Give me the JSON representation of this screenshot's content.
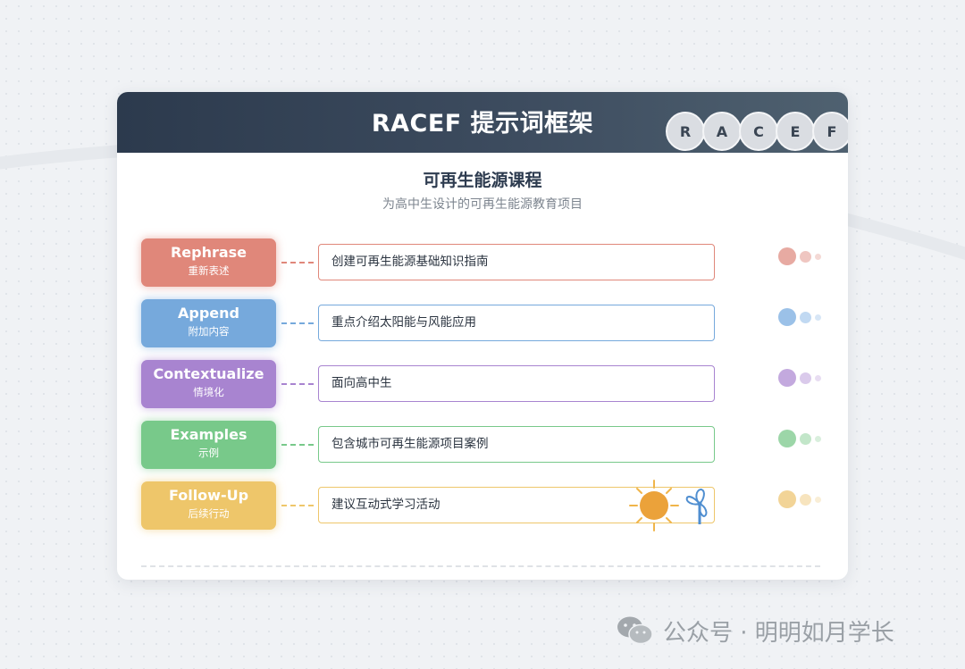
{
  "header": {
    "title": "RACEF 提示词框架",
    "letters": [
      "R",
      "A",
      "C",
      "E",
      "F"
    ]
  },
  "project": {
    "title": "可再生能源课程",
    "description": "为高中生设计的可再生能源教育项目"
  },
  "steps": [
    {
      "label": "Rephrase",
      "label_zh": "重新表述",
      "content": "创建可再生能源基础知识指南",
      "color": "#e0877a"
    },
    {
      "label": "Append",
      "label_zh": "附加内容",
      "content": "重点介绍太阳能与风能应用",
      "color": "#76a9dc"
    },
    {
      "label": "Contextualize",
      "label_zh": "情境化",
      "content": "面向高中生",
      "color": "#a884d0"
    },
    {
      "label": "Examples",
      "label_zh": "示例",
      "content": "包含城市可再生能源项目案例",
      "color": "#78c98a"
    },
    {
      "label": "Follow-Up",
      "label_zh": "后续行动",
      "content": "建议互动式学习活动",
      "color": "#eec66a"
    }
  ],
  "watermark": {
    "text": "公众号 · 明明如月学长"
  }
}
